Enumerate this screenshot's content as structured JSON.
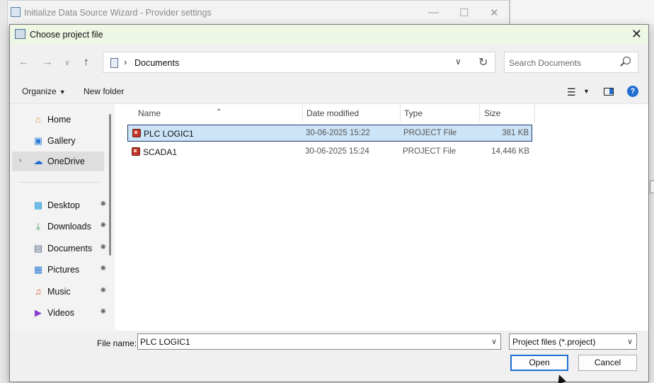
{
  "wizard": {
    "title": "Initialize Data Source Wizard - Provider settings"
  },
  "dialog": {
    "title": "Choose project file"
  },
  "address": {
    "crumb": "Documents"
  },
  "search": {
    "placeholder": "Search Documents"
  },
  "toolbar": {
    "organize": "Organize",
    "new_folder": "New folder"
  },
  "sidebar": {
    "items": [
      {
        "label": "Home",
        "icon": "home-icon"
      },
      {
        "label": "Gallery",
        "icon": "gallery-icon"
      },
      {
        "label": "OneDrive",
        "icon": "onedrive-icon"
      },
      {
        "label": "Desktop",
        "icon": "desktop-icon"
      },
      {
        "label": "Downloads",
        "icon": "downloads-icon"
      },
      {
        "label": "Documents",
        "icon": "documents-icon"
      },
      {
        "label": "Pictures",
        "icon": "pictures-icon"
      },
      {
        "label": "Music",
        "icon": "music-icon"
      },
      {
        "label": "Videos",
        "icon": "videos-icon"
      }
    ]
  },
  "columns": {
    "name": "Name",
    "date": "Date modified",
    "type": "Type",
    "size": "Size"
  },
  "files": [
    {
      "name": "PLC LOGIC1",
      "date": "30-06-2025 15:22",
      "type": "PROJECT File",
      "size": "381 KB"
    },
    {
      "name": "SCADA1",
      "date": "30-06-2025 15:24",
      "type": "PROJECT File",
      "size": "14,446 KB"
    }
  ],
  "footer": {
    "file_name_label": "File name:",
    "file_name_value": "PLC LOGIC1",
    "filter": "Project files (*.project)",
    "open": "Open",
    "cancel": "Cancel"
  },
  "colors": {
    "accent": "#1f6fd0",
    "selection": "#cce4f7",
    "title_tint": "#eef6e4"
  }
}
